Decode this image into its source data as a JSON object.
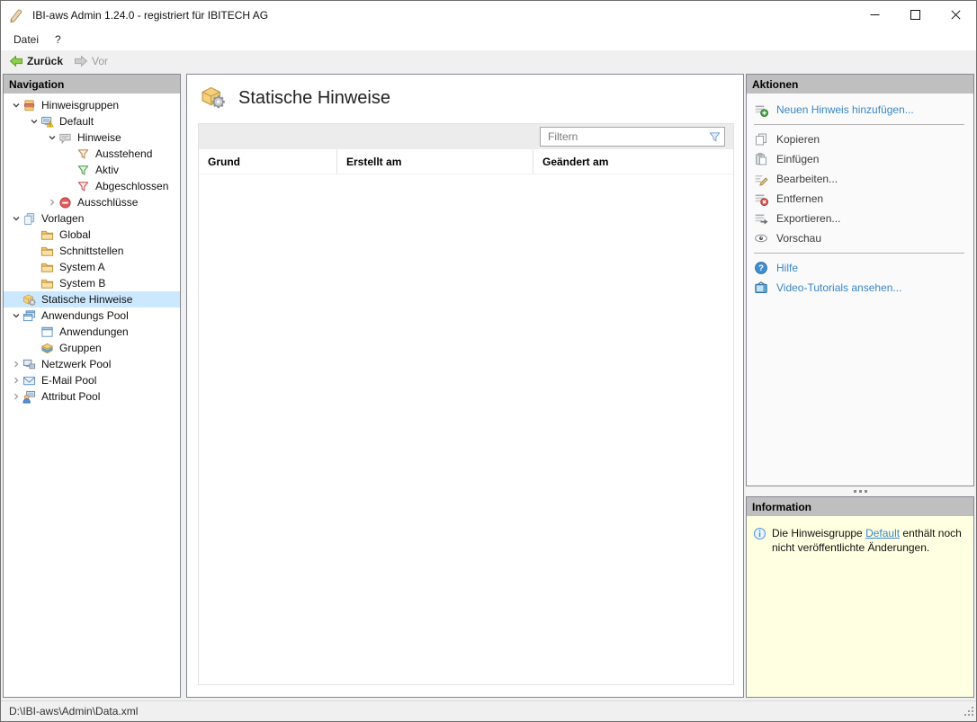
{
  "window": {
    "title": "IBI-aws Admin 1.24.0 - registriert für IBITECH AG",
    "app_icon": "stylus-tool"
  },
  "menu": {
    "items": [
      {
        "label": "Datei"
      },
      {
        "label": "?"
      }
    ]
  },
  "toolbar": {
    "back_label": "Zurück",
    "forward_label": "Vor",
    "back_enabled": true,
    "forward_enabled": false
  },
  "navigation": {
    "header": "Navigation",
    "items": [
      {
        "label": "Hinweisgruppen",
        "level": 0,
        "expander": "open",
        "icon": "notice-groups"
      },
      {
        "label": "Default",
        "level": 1,
        "expander": "open",
        "icon": "notice-group-warning"
      },
      {
        "label": "Hinweise",
        "level": 2,
        "expander": "open",
        "icon": "notices"
      },
      {
        "label": "Ausstehend",
        "level": 3,
        "expander": "none",
        "icon": "filter-pending"
      },
      {
        "label": "Aktiv",
        "level": 3,
        "expander": "none",
        "icon": "filter-active"
      },
      {
        "label": "Abgeschlossen",
        "level": 3,
        "expander": "none",
        "icon": "filter-completed"
      },
      {
        "label": "Ausschlüsse",
        "level": 2,
        "expander": "closed",
        "icon": "exclusions"
      },
      {
        "label": "Vorlagen",
        "level": 0,
        "expander": "open",
        "icon": "templates"
      },
      {
        "label": "Global",
        "level": 1,
        "expander": "none",
        "icon": "folder"
      },
      {
        "label": "Schnittstellen",
        "level": 1,
        "expander": "none",
        "icon": "folder"
      },
      {
        "label": "System A",
        "level": 1,
        "expander": "none",
        "icon": "folder"
      },
      {
        "label": "System B",
        "level": 1,
        "expander": "none",
        "icon": "folder"
      },
      {
        "label": "Statische Hinweise",
        "level": 0,
        "expander": "none",
        "icon": "static-notices",
        "selected": true
      },
      {
        "label": "Anwendungs Pool",
        "level": 0,
        "expander": "open",
        "icon": "app-pool"
      },
      {
        "label": "Anwendungen",
        "level": 1,
        "expander": "none",
        "icon": "application"
      },
      {
        "label": "Gruppen",
        "level": 1,
        "expander": "none",
        "icon": "groups"
      },
      {
        "label": "Netzwerk Pool",
        "level": 0,
        "expander": "closed",
        "icon": "network-pool"
      },
      {
        "label": "E-Mail Pool",
        "level": 0,
        "expander": "closed",
        "icon": "email-pool"
      },
      {
        "label": "Attribut Pool",
        "level": 0,
        "expander": "closed",
        "icon": "attribute-pool"
      }
    ]
  },
  "main": {
    "title": "Statische Hinweise",
    "title_icon": "static-notices",
    "filter_placeholder": "Filtern",
    "table": {
      "columns": [
        "Grund",
        "Erstellt am",
        "Geändert am"
      ],
      "rows": []
    }
  },
  "actions": {
    "header": "Aktionen",
    "items": [
      {
        "type": "link",
        "label": "Neuen Hinweis hinzufügen...",
        "icon": "add-notice"
      },
      {
        "type": "separator"
      },
      {
        "type": "item",
        "label": "Kopieren",
        "icon": "copy"
      },
      {
        "type": "item",
        "label": "Einfügen",
        "icon": "paste"
      },
      {
        "type": "item",
        "label": "Bearbeiten...",
        "icon": "edit"
      },
      {
        "type": "item",
        "label": "Entfernen",
        "icon": "remove"
      },
      {
        "type": "item",
        "label": "Exportieren...",
        "icon": "export"
      },
      {
        "type": "item",
        "label": "Vorschau",
        "icon": "preview"
      },
      {
        "type": "separator"
      },
      {
        "type": "link",
        "label": "Hilfe",
        "icon": "help"
      },
      {
        "type": "link",
        "label": "Video-Tutorials ansehen...",
        "icon": "video"
      }
    ]
  },
  "information": {
    "header": "Information",
    "icon": "info",
    "message_prefix": "Die Hinweisgruppe ",
    "message_link": "Default",
    "message_suffix": " enthält noch nicht veröffentlichte Änderungen."
  },
  "statusbar": {
    "path": "D:\\IBI-aws\\Admin\\Data.xml"
  },
  "colors": {
    "link_blue": "#3a87c8",
    "selection_blue": "#cce8ff",
    "panel_header_gray": "#bfbfbf",
    "info_yellow": "#ffffe1",
    "filter_pending": "#bf8a50",
    "filter_active": "#4aa54a",
    "filter_completed": "#cc5555",
    "back_arrow_green": "#8ccf4a"
  }
}
